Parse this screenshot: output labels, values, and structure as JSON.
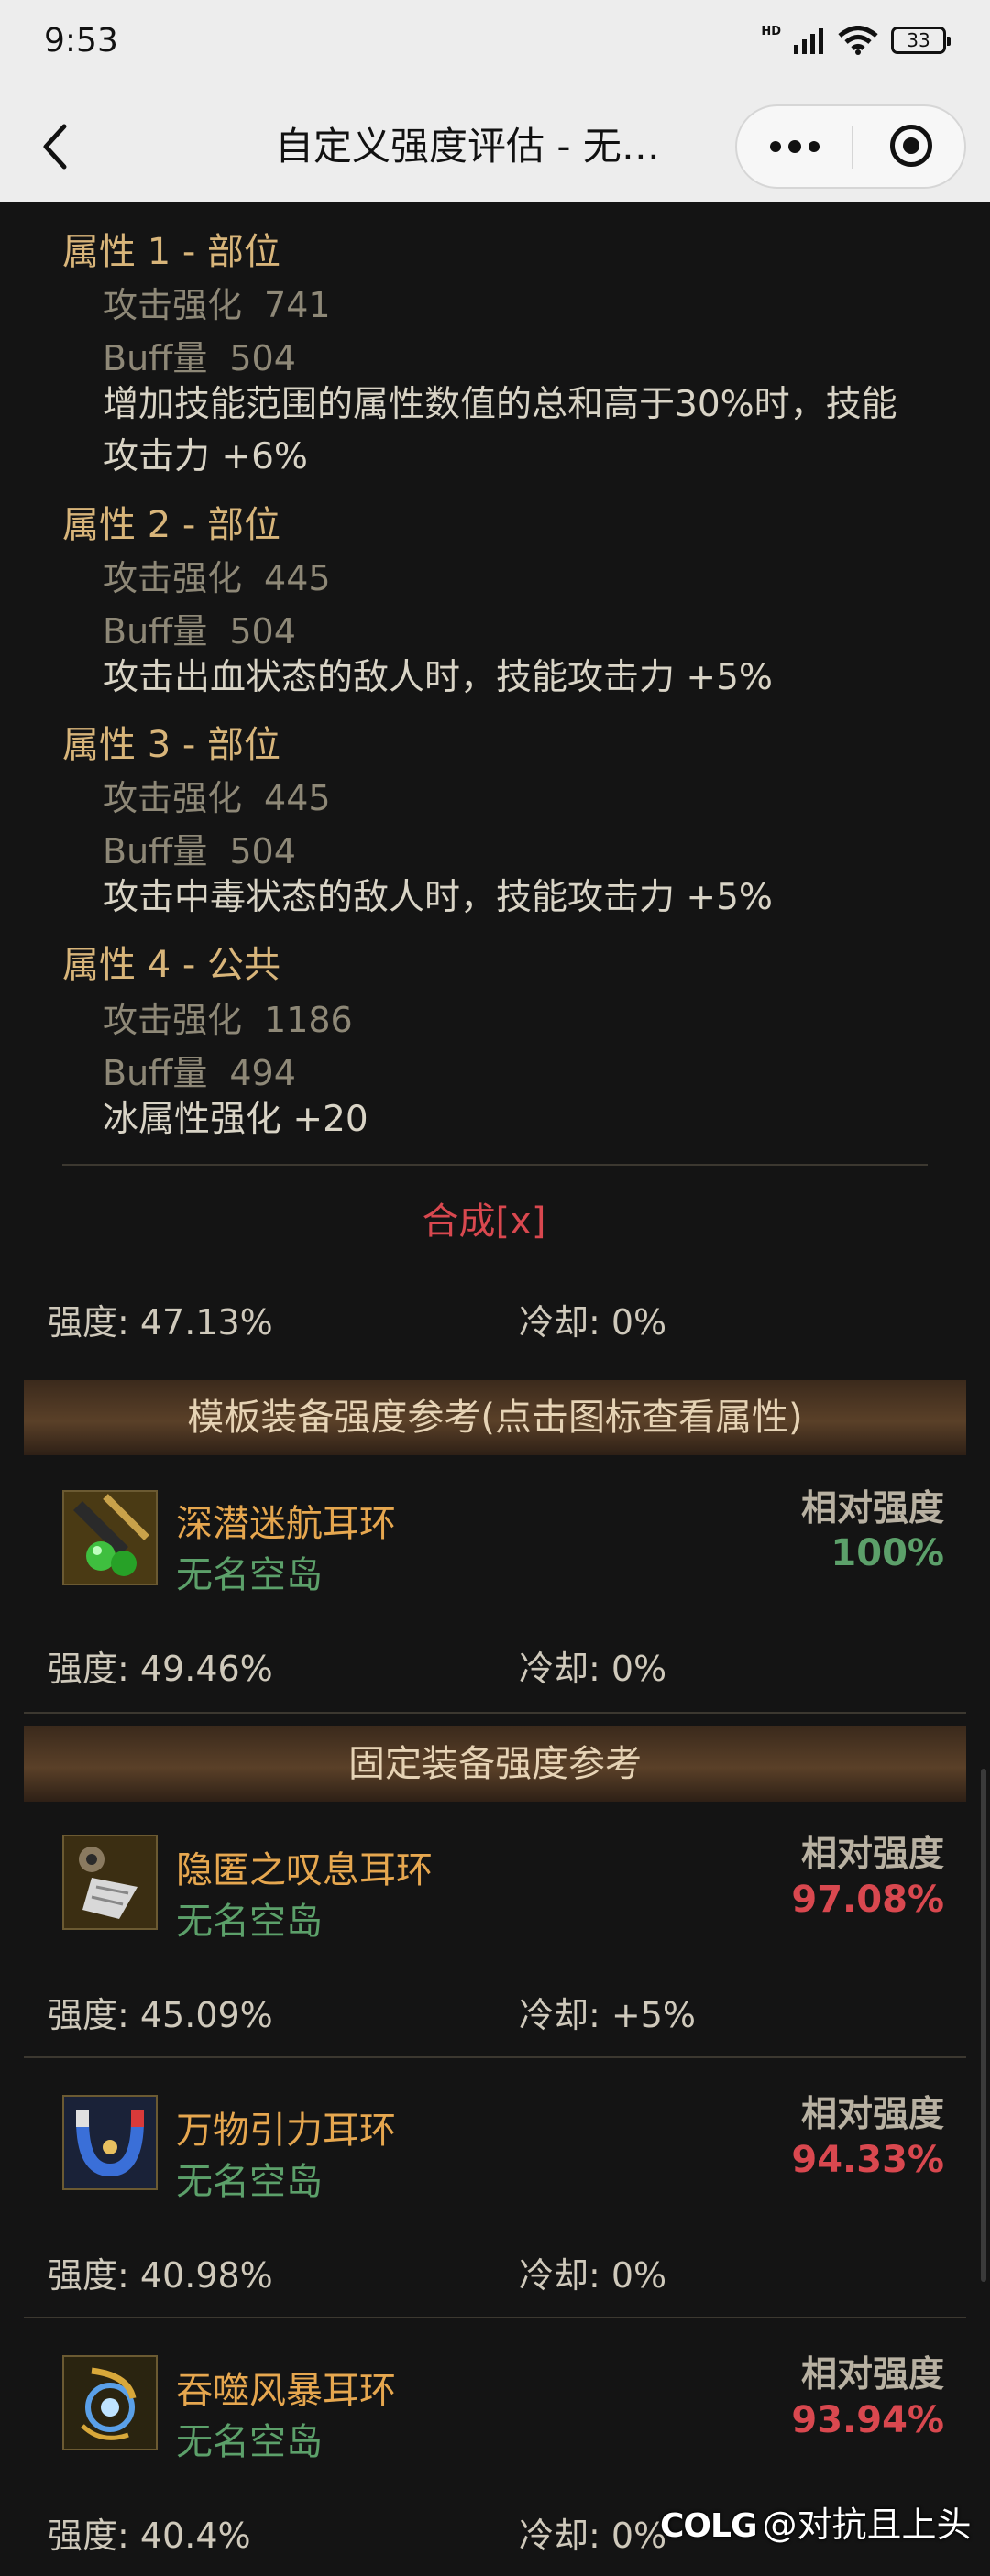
{
  "status_bar": {
    "time": "9:53",
    "network": "HD",
    "battery": "33"
  },
  "nav": {
    "title": "自定义强度评估 - 无…"
  },
  "attributes": [
    {
      "heading": "属性 1 - 部位",
      "atk_label": "攻击强化",
      "atk_value": "741",
      "buff_label": "Buff量",
      "buff_value": "504",
      "desc": "增加技能范围的属性数值的总和高于30%时，技能攻击力 +6%"
    },
    {
      "heading": "属性 2 - 部位",
      "atk_label": "攻击强化",
      "atk_value": "445",
      "buff_label": "Buff量",
      "buff_value": "504",
      "desc": "攻击出血状态的敌人时，技能攻击力 +5%"
    },
    {
      "heading": "属性 3 - 部位",
      "atk_label": "攻击强化",
      "atk_value": "445",
      "buff_label": "Buff量",
      "buff_value": "504",
      "desc": "攻击中毒状态的敌人时，技能攻击力 +5%"
    },
    {
      "heading": "属性 4 - 公共",
      "atk_label": "攻击强化",
      "atk_value": "1186",
      "buff_label": "Buff量",
      "buff_value": "494",
      "desc": "冰属性强化 +20"
    }
  ],
  "synthesis_label": "合成[x]",
  "custom_stats": {
    "strength": "强度: 47.13%",
    "cooldown": "冷却: 0%"
  },
  "template_section": {
    "title": "模板装备强度参考(点击图标查看属性)",
    "items": [
      {
        "name": "深潜迷航耳环",
        "source": "无名空岛",
        "rel_label": "相对强度",
        "rel_value": "100%",
        "rel_color": "#5ca06a",
        "strength": "强度: 49.46%",
        "cooldown": "冷却: 0%",
        "icon": "earring-icon-green"
      }
    ]
  },
  "fixed_section": {
    "title": "固定装备强度参考",
    "items": [
      {
        "name": "隐匿之叹息耳环",
        "source": "无名空岛",
        "rel_label": "相对强度",
        "rel_value": "97.08%",
        "rel_color": "#d9484f",
        "strength": "强度: 45.09%",
        "cooldown": "冷却: +5%",
        "icon": "earring-icon-bell"
      },
      {
        "name": "万物引力耳环",
        "source": "无名空岛",
        "rel_label": "相对强度",
        "rel_value": "94.33%",
        "rel_color": "#d9484f",
        "strength": "强度: 40.98%",
        "cooldown": "冷却: 0%",
        "icon": "earring-icon-magnet"
      },
      {
        "name": "吞噬风暴耳环",
        "source": "无名空岛",
        "rel_label": "相对强度",
        "rel_value": "93.94%",
        "rel_color": "#d9484f",
        "strength": "强度: 40.4%",
        "cooldown": "冷却: 0%",
        "icon": "earring-icon-storm"
      }
    ]
  },
  "watermark": {
    "brand": "COLG",
    "user": "@对抗且上头"
  }
}
